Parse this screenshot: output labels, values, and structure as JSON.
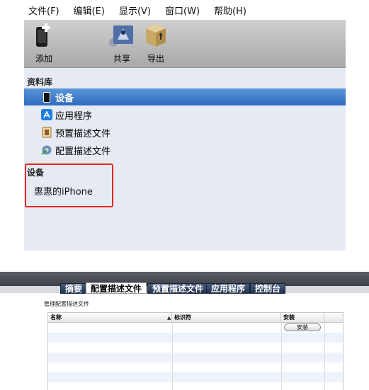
{
  "menu": [
    {
      "label": "文件(F)"
    },
    {
      "label": "编辑(E)"
    },
    {
      "label": "显示(V)"
    },
    {
      "label": "窗口(W)"
    },
    {
      "label": "帮助(H)"
    }
  ],
  "toolbar": {
    "add_label": "添加",
    "share_label": "共享",
    "export_label": "导出"
  },
  "library": {
    "title": "资料库",
    "items": [
      {
        "label": "设备",
        "icon": "device-icon",
        "selected": true
      },
      {
        "label": "应用程序",
        "icon": "app-store-icon",
        "selected": false
      },
      {
        "label": "预置描述文件",
        "icon": "provisioning-profile-icon",
        "selected": false
      },
      {
        "label": "配置描述文件",
        "icon": "configuration-profile-icon",
        "selected": false
      }
    ]
  },
  "devices": {
    "title": "设备",
    "items": [
      {
        "label": "惠惠的iPhone"
      }
    ]
  },
  "tabs": [
    {
      "label": "摘要",
      "active": false
    },
    {
      "label": "配置描述文件",
      "active": true
    },
    {
      "label": "预置描述文件",
      "active": false
    },
    {
      "label": "应用程序",
      "active": false
    },
    {
      "label": "控制台",
      "active": false
    }
  ],
  "manage_label": "管理配置描述文件",
  "table": {
    "columns": [
      "名称",
      "标识符",
      "安装"
    ],
    "install_button": "安装"
  },
  "colors": {
    "selection": "#2e6bbf",
    "highlight_box": "#e8241f",
    "tab_dark": "#22324f"
  }
}
